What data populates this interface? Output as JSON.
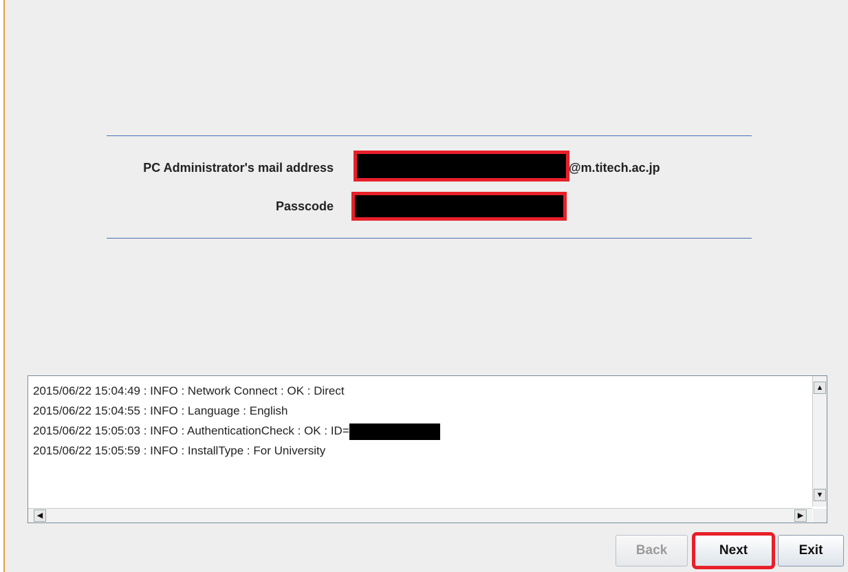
{
  "form": {
    "mail_label": "PC Administrator's mail address",
    "mail_domain": "@m.titech.ac.jp",
    "passcode_label": "Passcode"
  },
  "log": {
    "lines": [
      "2015/06/22 15:04:49 : INFO  : Network Connect : OK : Direct",
      "2015/06/22 15:04:55 : INFO  : Language : English",
      "2015/06/22 15:05:03 : INFO  : AuthenticationCheck : OK : ID=",
      "2015/06/22 15:05:59 : INFO  : InstallType : For University"
    ]
  },
  "buttons": {
    "back": "Back",
    "next": "Next",
    "exit": "Exit"
  },
  "icons": {
    "scroll_up": "arrow-up-icon",
    "scroll_down": "arrow-down-icon",
    "scroll_left": "arrow-left-icon",
    "scroll_right": "arrow-right-icon"
  },
  "colors": {
    "highlight": "#e8202a",
    "divider": "#4a6fb5"
  }
}
